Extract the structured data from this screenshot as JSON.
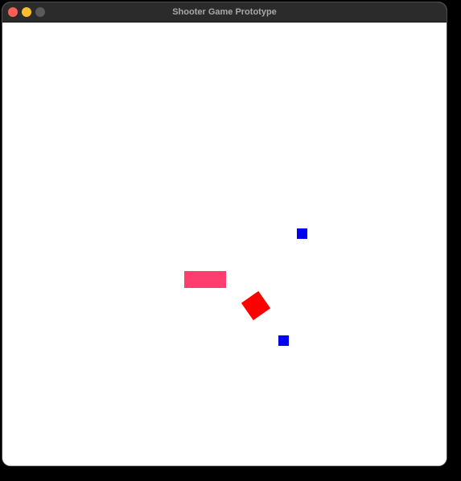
{
  "window": {
    "title": "Shooter Game Prototype"
  },
  "colors": {
    "titlebar": "#2b2b2b",
    "close_button": "#ff5f57",
    "minimize_button": "#febc2e",
    "zoom_button": "#5a5a5a",
    "background": "#ffffff",
    "player": "#ff0000",
    "platform": "#ff3d6e",
    "enemy": "#0000ee"
  },
  "scene": {
    "player": {
      "shape": "square",
      "color": "#ff0000"
    },
    "platform": {
      "shape": "rectangle",
      "color": "#ff3d6e"
    },
    "enemies": [
      {
        "shape": "square",
        "color": "#0000ee"
      },
      {
        "shape": "square",
        "color": "#0000ee"
      }
    ]
  }
}
